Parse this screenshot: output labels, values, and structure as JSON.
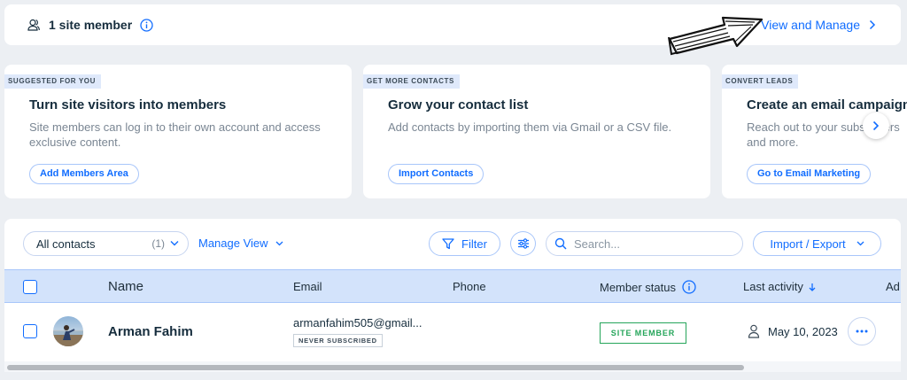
{
  "members_bar": {
    "count_label": "1 site member",
    "manage_link": "View and Manage"
  },
  "cards": [
    {
      "tag": "SUGGESTED FOR YOU",
      "title": "Turn site visitors into members",
      "description": "Site members can log in to their own account and access exclusive content.",
      "button": "Add Members Area"
    },
    {
      "tag": "GET MORE CONTACTS",
      "title": "Grow your contact list",
      "description": "Add contacts by importing them via Gmail or a CSV file.",
      "button": "Import Contacts"
    },
    {
      "tag": "CONVERT LEADS",
      "title": "Create an email campaign",
      "description": "Reach out to your subscribers and more.",
      "button": "Go to Email Marketing"
    }
  ],
  "toolbar": {
    "contacts_select": "All contacts",
    "contacts_count": "(1)",
    "manage_view": "Manage View",
    "filter": "Filter",
    "search_placeholder": "Search...",
    "import_export": "Import / Export"
  },
  "table": {
    "columns": [
      "Name",
      "Email",
      "Phone",
      "Member status",
      "Last activity",
      "Ad"
    ],
    "rows": [
      {
        "name": "Arman Fahim",
        "email": "armanfahim505@gmail...",
        "email_badge": "NEVER SUBSCRIBED",
        "phone": "",
        "member_status": "SITE MEMBER",
        "last_activity": "May 10, 2023"
      }
    ]
  },
  "colors": {
    "accent": "#116dff",
    "header_bg": "#d3e3fb",
    "success": "#25a55a",
    "page_bg": "#eceff3"
  }
}
